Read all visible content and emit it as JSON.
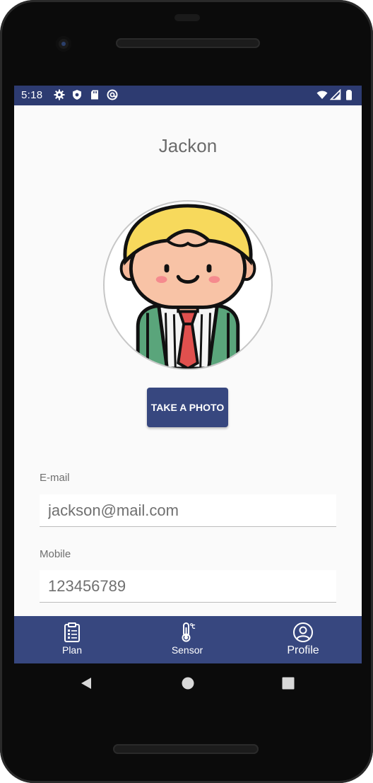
{
  "status_bar": {
    "time": "5:18",
    "left_icons": [
      "gear-icon",
      "shield-icon",
      "sd-card-icon",
      "at-sign-icon"
    ],
    "right_icons": [
      "wifi-icon",
      "signal-icon",
      "battery-icon"
    ]
  },
  "profile": {
    "name": "Jackon",
    "avatar": "boy-avatar-icon",
    "take_photo_label": "TAKE A PHOTO"
  },
  "fields": {
    "email_label": "E-mail",
    "email_value": "jackson@mail.com",
    "mobile_label": "Mobile",
    "mobile_value": "123456789"
  },
  "bottom_nav": {
    "items": [
      {
        "label": "Plan",
        "icon": "clipboard-icon"
      },
      {
        "label": "Sensor",
        "icon": "thermometer-icon"
      },
      {
        "label": "Profile",
        "icon": "user-circle-icon",
        "active": true
      }
    ]
  },
  "colors": {
    "primary": "#37477f",
    "status_bar": "#2d3b71",
    "background": "#fafafa"
  }
}
